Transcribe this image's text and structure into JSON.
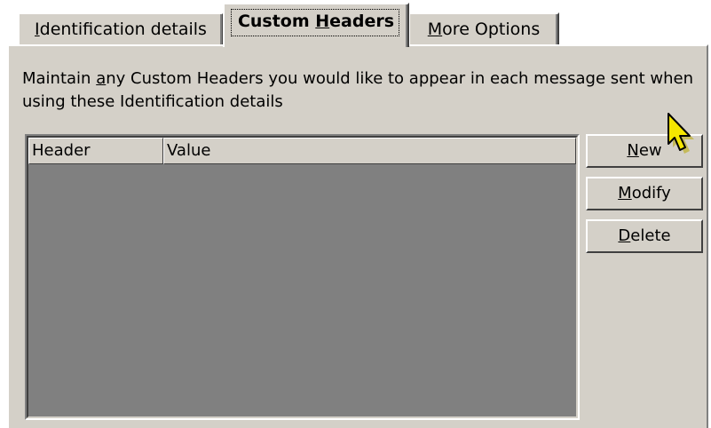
{
  "tabs": [
    {
      "label_before": "",
      "label_mnemonic": "I",
      "label_after": "dentification details"
    },
    {
      "label_before": "Custom ",
      "label_mnemonic": "H",
      "label_after": "eaders"
    },
    {
      "label_before": "",
      "label_mnemonic": "M",
      "label_after": "ore Options"
    }
  ],
  "description": {
    "before": "Maintain ",
    "mnemonic": "a",
    "after": "ny Custom Headers you would like to appear in each message sent when using these Identification details"
  },
  "list": {
    "columns": [
      "Header",
      "Value"
    ]
  },
  "buttons": {
    "new": {
      "mnemonic": "N",
      "rest": "ew"
    },
    "modify": {
      "mnemonic": "M",
      "rest": "odify"
    },
    "delete": {
      "mnemonic": "D",
      "rest": "elete"
    }
  },
  "icons": {
    "cursor": "yellow-arrow-pointer-icon"
  },
  "colors": {
    "dialog_face": "#d4d0c8",
    "list_background": "#808080",
    "cursor_fill": "#f5e600"
  }
}
